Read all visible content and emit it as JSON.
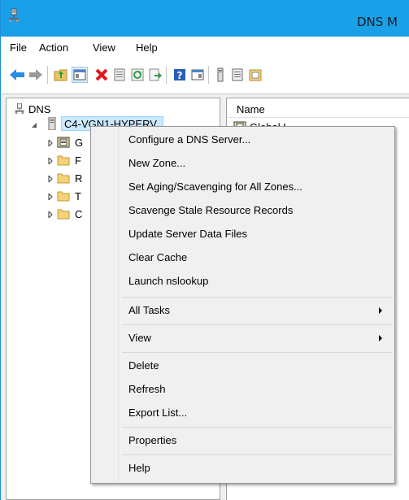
{
  "window": {
    "title": "DNS M",
    "accent_color": "#19a0e8"
  },
  "menubar": {
    "items": [
      {
        "label": "File"
      },
      {
        "label": "Action"
      },
      {
        "label": "View"
      },
      {
        "label": "Help"
      }
    ]
  },
  "toolbar": {
    "buttons": [
      {
        "icon": "back-arrow-icon"
      },
      {
        "icon": "forward-arrow-icon"
      },
      {
        "icon": "up-folder-icon"
      },
      {
        "icon": "show-hide-tree-icon"
      },
      {
        "icon": "delete-icon"
      },
      {
        "icon": "properties-icon"
      },
      {
        "icon": "refresh-icon"
      },
      {
        "icon": "export-list-icon"
      },
      {
        "icon": "help-icon"
      },
      {
        "icon": "show-action-pane-icon"
      },
      {
        "icon": "server-icon"
      },
      {
        "icon": "records-icon"
      },
      {
        "icon": "zone-icon"
      }
    ]
  },
  "tree": {
    "root": {
      "label": "DNS"
    },
    "server": {
      "label": "C4-VGN1-HYPERV"
    },
    "children": [
      {
        "label": "G",
        "icon": "global-logs-icon"
      },
      {
        "label": "F",
        "icon": "folder-icon"
      },
      {
        "label": "R",
        "icon": "folder-icon"
      },
      {
        "label": "T",
        "icon": "folder-icon"
      },
      {
        "label": "C",
        "icon": "folder-icon"
      }
    ]
  },
  "list": {
    "columns": [
      {
        "label": "Name"
      }
    ],
    "first_row_fragment": "Global L"
  },
  "context_menu": {
    "items": [
      {
        "label": "Configure a DNS Server..."
      },
      {
        "label": "New Zone..."
      },
      {
        "label": "Set Aging/Scavenging for All Zones..."
      },
      {
        "label": "Scavenge Stale Resource Records"
      },
      {
        "label": "Update Server Data Files"
      },
      {
        "label": "Clear Cache"
      },
      {
        "label": "Launch nslookup"
      },
      {
        "label": "All Tasks",
        "submenu": true
      },
      {
        "label": "View",
        "submenu": true
      },
      {
        "label": "Delete"
      },
      {
        "label": "Refresh"
      },
      {
        "label": "Export List..."
      },
      {
        "label": "Properties"
      },
      {
        "label": "Help"
      }
    ]
  }
}
